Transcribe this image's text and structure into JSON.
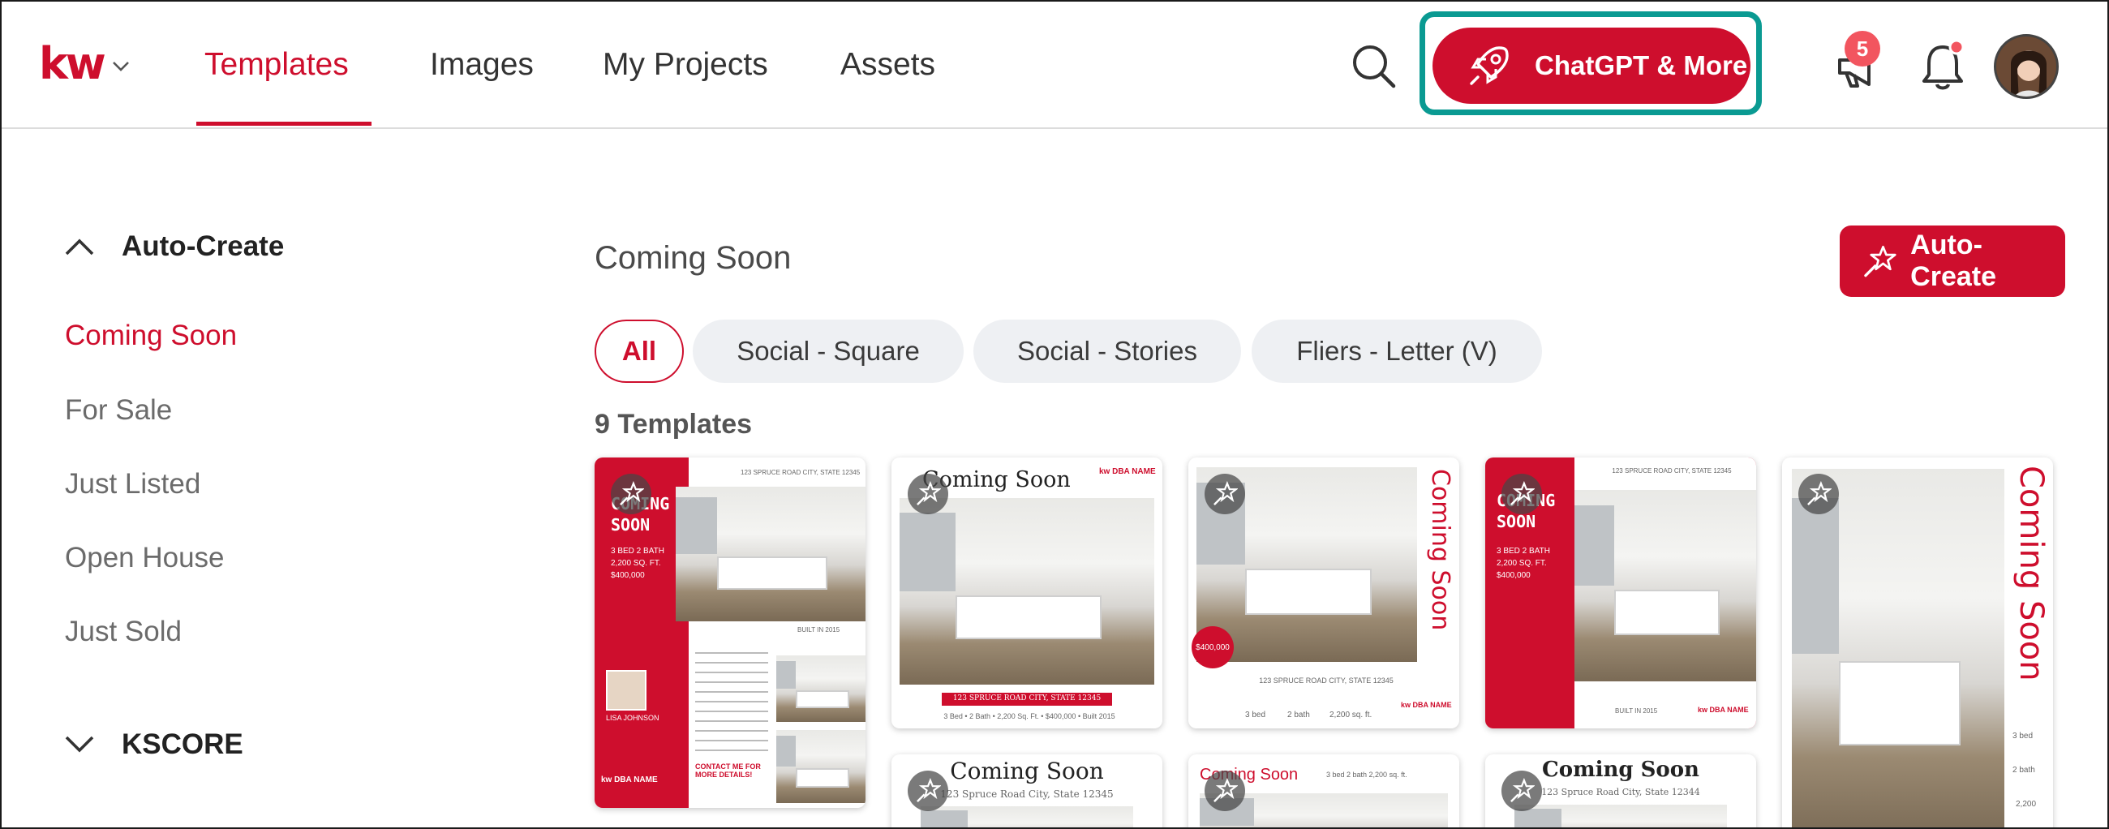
{
  "colors": {
    "brand": "#ce0e2d",
    "highlight": "#0a9a92",
    "chip_bg": "#eef0f3"
  },
  "header": {
    "logo_text": "kw",
    "nav": [
      {
        "label": "Templates",
        "active": true
      },
      {
        "label": "Images"
      },
      {
        "label": "My Projects"
      },
      {
        "label": "Assets"
      }
    ],
    "icons": [
      "search-icon",
      "rocket-icon",
      "megaphone-icon",
      "bell-icon"
    ],
    "chatgpt_button": "ChatGPT & More",
    "notification_count": "5"
  },
  "sidebar": {
    "auto_create_heading": "Auto-Create",
    "items": [
      {
        "label": "Coming Soon",
        "active": true
      },
      {
        "label": "For Sale"
      },
      {
        "label": "Just Listed"
      },
      {
        "label": "Open House"
      },
      {
        "label": "Just Sold"
      }
    ],
    "kscore_heading": "KSCORE"
  },
  "main": {
    "title": "Coming Soon",
    "auto_create_button": "Auto-Create",
    "chips": [
      {
        "label": "All",
        "active": true
      },
      {
        "label": "Social - Square"
      },
      {
        "label": "Social - Stories"
      },
      {
        "label": "Fliers - Letter (V)"
      }
    ],
    "count_label": "9 Templates",
    "cards": {
      "c1": {
        "headline": "COMING SOON",
        "address": "123 SPRUCE ROAD CITY, STATE 12345",
        "details": "3 BED 2 BATH 2,200 SQ. FT. $400,000",
        "agent": "LISA JOHNSON",
        "contact": "CONTACT ME FOR MORE DETAILS!",
        "built": "BUILT IN 2015",
        "brand": "kw DBA NAME"
      },
      "c2": {
        "headline": "Coming Soon",
        "address": "123 SPRUCE ROAD CITY, STATE 12345",
        "stats": "3 Bed • 2 Bath • 2,200 Sq. Ft. • $400,000 • Built 2015",
        "brand": "kw DBA NAME"
      },
      "c3": {
        "headline": "Coming Soon",
        "price": "$400,000",
        "address": "123 SPRUCE ROAD CITY, STATE 12345",
        "beds": "3 bed",
        "baths": "2 bath",
        "sqft": "2,200 sq. ft.",
        "brand": "kw DBA NAME"
      },
      "c4": {
        "headline": "COMING SOON",
        "address": "123 SPRUCE ROAD CITY, STATE 12345",
        "details": "3 BED 2 BATH 2,200 SQ. FT. $400,000",
        "built": "BUILT IN 2015",
        "brand": "kw DBA NAME"
      },
      "c5": {
        "headline": "Coming Soon",
        "beds": "3 bed",
        "baths": "2 bath",
        "sqft": "2,200"
      },
      "c6": {
        "headline": "Coming Soon",
        "address": "123 Spruce Road City, State 12345"
      },
      "c7": {
        "headline": "Coming Soon",
        "stats": "3 bed  2 bath  2,200 sq. ft."
      },
      "c8": {
        "headline": "Coming Soon",
        "address": "123 Spruce Road City, State 12344"
      }
    }
  }
}
